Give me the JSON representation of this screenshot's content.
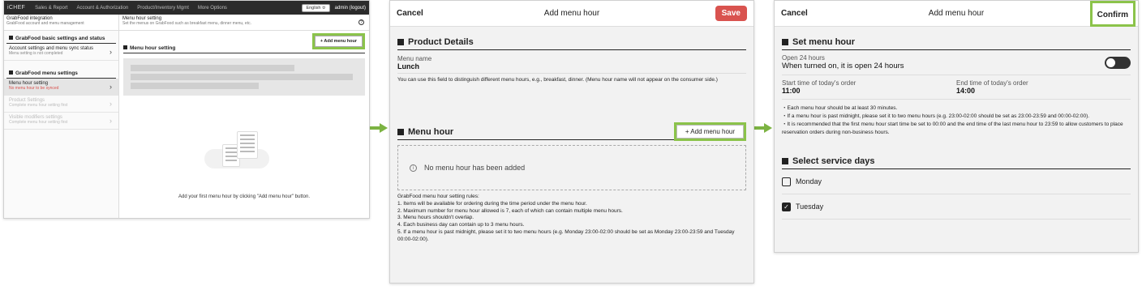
{
  "panel1": {
    "topbar": {
      "brand": "iCHEF",
      "nav": [
        "Sales & Report",
        "Account & Authorization",
        "Product/Inventory Mgmt",
        "More Options"
      ],
      "language": "English ≎",
      "user": "admin (logout)"
    },
    "subheader": {
      "left_title": "GrabFood integration",
      "left_sub": "GrabFood account and menu management",
      "right_title": "Menu hour setting",
      "right_sub": "Set the menus on GrabFood such as breakfast menu, dinner menu, etc."
    },
    "sidebar": {
      "section1": "GrabFood basic settings and status",
      "item1_label": "Account settings and menu sync status",
      "item1_sub": "Menu setting is not completed",
      "section2": "GrabFood menu settings",
      "item2_label": "Menu hour setting",
      "item2_sub": "No menu hour to be synced",
      "item3_label": "Product Settings",
      "item3_sub": "Complete menu hour setting first",
      "item4_label": "Visible modifiers settings",
      "item4_sub": "Complete menu hour setting first"
    },
    "main": {
      "section_title": "Menu hour setting",
      "add_button": "+ Add menu hour",
      "empty_text": "Add your first menu hour by clicking \"Add menu hour\" button."
    }
  },
  "panel2": {
    "header": {
      "cancel": "Cancel",
      "title": "Add menu hour",
      "save": "Save"
    },
    "product_details": {
      "title": "Product Details",
      "name_label": "Menu name",
      "name_value": "Lunch",
      "note": "You can use this field to distinguish different menu hours, e.g., breakfast, dinner. (Menu hour name will not appear on the consumer side.)"
    },
    "menu_hour": {
      "title": "Menu hour",
      "add_button": "+ Add menu hour",
      "empty": "No menu hour has been added",
      "rules": [
        "GrabFood menu hour setting rules:",
        "1. Items will be available for ordering during the time period under the menu hour.",
        "2. Maximum number for menu hour allowed is 7, each of which can contain multiple menu hours.",
        "3. Menu hours shouldn't overlap.",
        "4. Each business day can contain up to 3 menu hours.",
        "5. If a menu hour is past midnight, please set it to two menu hours (e.g. Monday 23:00-02:00 should be set as Monday 23:00-23:59 and Tuesday 00:00-02:00)."
      ]
    }
  },
  "panel3": {
    "header": {
      "cancel": "Cancel",
      "title": "Add menu hour",
      "confirm": "Confirm"
    },
    "set_menu_hour": {
      "title": "Set menu hour",
      "open24_label": "Open 24 hours",
      "open24_desc": "When turned on, it is open 24 hours",
      "open24_on": false,
      "start_label": "Start time of today's order",
      "start_value": "11:00",
      "end_label": "End time of today's order",
      "end_value": "14:00",
      "tips": [
        "・Each menu hour should be at least 30 minutes.",
        "・If a menu hour is past midnight, please set it to two menu hours (e.g. 23:00-02:00 should be set as 23:00-23:59 and 00:00-02:00).",
        "・It is recommended that the first menu hour start time be set to 00:00 and the end time of the last menu hour to 23:59 to allow customers to place reservation orders during non-business hours."
      ]
    },
    "service_days": {
      "title": "Select service days",
      "days": [
        {
          "label": "Monday",
          "checked": false
        },
        {
          "label": "Tuesday",
          "checked": true
        }
      ]
    }
  },
  "colors": {
    "highlight": "#8bc34a",
    "save": "#d9534f",
    "arrow": "#7cb342"
  }
}
